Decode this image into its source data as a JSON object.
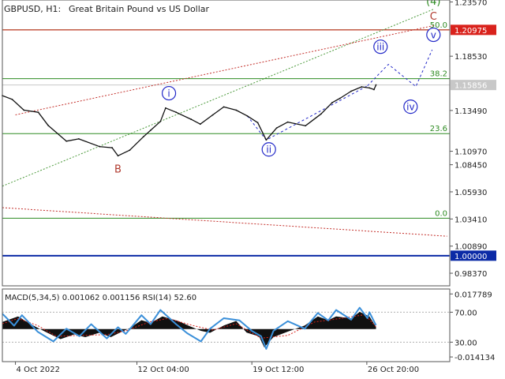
{
  "chart_data": {
    "type": "line",
    "symbol": "GBPUSD, H1:",
    "instrument": "Great Britain Pound vs US Dollar",
    "price_axis": {
      "ticks": [
        1.2357,
        1.1853,
        1.1349,
        1.097,
        1.0845,
        1.0593,
        1.0341,
        1.0089,
        0.9837
      ],
      "tick_labels": [
        "1.23570",
        "1.18530",
        "1.13490",
        "1.10970",
        "1.08450",
        "1.05930",
        "1.03410",
        "1.00890",
        "0.98370"
      ],
      "range": [
        0.972,
        1.2375
      ]
    },
    "price_tags": [
      {
        "value": 1.20975,
        "label": "1.20975",
        "color": "#d9221c",
        "text_color": "#ffffff"
      },
      {
        "value": 1.15856,
        "label": "1.15856",
        "color": "#c8c8c8",
        "text_color": "#ffffff"
      },
      {
        "value": 1.0,
        "label": "1.00000",
        "color": "#0b2aa6",
        "text_color": "#ffffff"
      }
    ],
    "fib_levels": [
      {
        "label": "50.0",
        "value": 1.2098
      },
      {
        "label": "38.2",
        "value": 1.1644
      },
      {
        "label": "23.6",
        "value": 1.1134
      },
      {
        "label": "0.0",
        "value": 1.0348
      }
    ],
    "wave_labels": [
      {
        "text": "(4)",
        "date": "2022-10-31 02:00",
        "price": 1.2365,
        "color": "#2e8b22",
        "circled": false
      },
      {
        "text": "C",
        "date": "2022-10-31 02:00",
        "price": 1.2225,
        "color": "#b03a2e",
        "circled": false
      },
      {
        "text": "v",
        "date": "2022-10-31 02:00",
        "price": 1.2052,
        "color": "#2228c8",
        "circled": true
      },
      {
        "text": "iii",
        "date": "2022-10-27 17:00",
        "price": 1.1941,
        "color": "#2228c8",
        "circled": true
      },
      {
        "text": "iv",
        "date": "2022-10-29 15:00",
        "price": 1.1384,
        "color": "#2228c8",
        "circled": true
      },
      {
        "text": "i",
        "date": "2022-10-14 05:00",
        "price": 1.1509,
        "color": "#2228c8",
        "circled": true
      },
      {
        "text": "ii",
        "date": "2022-10-20 14:00",
        "price": 1.0987,
        "color": "#2228c8",
        "circled": true
      },
      {
        "text": "B",
        "date": "2022-10-10 23:00",
        "price": 1.0805,
        "color": "#b03a2e",
        "circled": false
      }
    ],
    "forecast_path": [
      {
        "date": "2022-10-26 21:00",
        "price": 1.1578
      },
      {
        "date": "2022-10-28 05:00",
        "price": 1.1777
      },
      {
        "date": "2022-10-29 23:00",
        "price": 1.1571
      },
      {
        "date": "2022-10-31 00:00",
        "price": 1.1913
      }
    ],
    "wave_ii_path": [
      {
        "date": "2022-10-19 05:00",
        "price": 1.1298
      },
      {
        "date": "2022-10-20 10:00",
        "price": 1.1075
      },
      {
        "date": "2022-10-26 21:00",
        "price": 1.1578
      }
    ],
    "trend_lines": [
      {
        "color": "#4c9a3c",
        "from": {
          "date": "2022-10-03 14:00",
          "price": 1.0646
        },
        "to": {
          "date": "2022-10-31 02:00",
          "price": 1.2289
        }
      },
      {
        "color": "#c4302b",
        "from": {
          "date": "2022-10-04 10:00",
          "price": 1.1308
        },
        "to": {
          "date": "2022-10-31 02:00",
          "price": 1.2137
        }
      },
      {
        "color": "#c4302b",
        "from": {
          "date": "2022-10-03 14:00",
          "price": 1.0446
        },
        "to": {
          "date": "2022-10-31 23:00",
          "price": 1.0181
        }
      }
    ],
    "price_series": [
      {
        "date": "2022-10-03 14:00",
        "price": 1.1487
      },
      {
        "date": "2022-10-04 05:00",
        "price": 1.1452
      },
      {
        "date": "2022-10-04 23:00",
        "price": 1.1352
      },
      {
        "date": "2022-10-05 21:00",
        "price": 1.1332
      },
      {
        "date": "2022-10-06 12:00",
        "price": 1.1211
      },
      {
        "date": "2022-10-07 16:00",
        "price": 1.1064
      },
      {
        "date": "2022-10-08 11:00",
        "price": 1.1085
      },
      {
        "date": "2022-10-09 19:00",
        "price": 1.1013
      },
      {
        "date": "2022-10-10 14:00",
        "price": 1.1003
      },
      {
        "date": "2022-10-10 23:00",
        "price": 1.0928
      },
      {
        "date": "2022-10-11 17:00",
        "price": 1.098
      },
      {
        "date": "2022-10-12 14:00",
        "price": 1.1105
      },
      {
        "date": "2022-10-13 01:00",
        "price": 1.1165
      },
      {
        "date": "2022-10-13 16:00",
        "price": 1.1247
      },
      {
        "date": "2022-10-14 00:00",
        "price": 1.1372
      },
      {
        "date": "2022-10-14 16:00",
        "price": 1.1332
      },
      {
        "date": "2022-10-15 15:00",
        "price": 1.1267
      },
      {
        "date": "2022-10-16 05:00",
        "price": 1.1222
      },
      {
        "date": "2022-10-17 00:00",
        "price": 1.1307
      },
      {
        "date": "2022-10-17 17:00",
        "price": 1.1382
      },
      {
        "date": "2022-10-18 12:00",
        "price": 1.1352
      },
      {
        "date": "2022-10-19 05:00",
        "price": 1.1298
      },
      {
        "date": "2022-10-19 21:00",
        "price": 1.1236
      },
      {
        "date": "2022-10-20 10:00",
        "price": 1.1075
      },
      {
        "date": "2022-10-21 02:00",
        "price": 1.1186
      },
      {
        "date": "2022-10-21 19:00",
        "price": 1.1241
      },
      {
        "date": "2022-10-22 22:00",
        "price": 1.1207
      },
      {
        "date": "2022-10-23 22:00",
        "price": 1.1317
      },
      {
        "date": "2022-10-24 15:00",
        "price": 1.1422
      },
      {
        "date": "2022-10-25 03:00",
        "price": 1.1462
      },
      {
        "date": "2022-10-25 20:00",
        "price": 1.1528
      },
      {
        "date": "2022-10-26 12:00",
        "price": 1.1568
      },
      {
        "date": "2022-10-27 00:00",
        "price": 1.1558
      },
      {
        "date": "2022-10-27 07:00",
        "price": 1.1543
      },
      {
        "date": "2022-10-27 10:00",
        "price": 1.1586
      }
    ],
    "x_axis": {
      "ticks": [
        "2022-10-04 10:00",
        "2022-10-12 04:00",
        "2022-10-19 12:00",
        "2022-10-26 20:00"
      ],
      "tick_labels": [
        "4 Oct 2022",
        "12 Oct 04:00",
        "19 Oct 12:00",
        "26 Oct 20:00"
      ],
      "range": [
        "2022-10-03 14:00",
        "2022-11-01 03:00"
      ]
    },
    "indicator": {
      "title": "MACD(5,34,5) 0.001062 0.001156 RSI(14) 52.60",
      "macd_axis": {
        "ticks": [
          0.017789,
          -0.014134
        ],
        "tick_labels": [
          "0.017789",
          "-0.014134"
        ],
        "range": [
          -0.0165,
          0.0203
        ]
      },
      "rsi_axis": {
        "ticks": [
          70,
          30
        ],
        "tick_labels": [
          "70.00",
          "30.00"
        ],
        "range": [
          4,
          101
        ]
      },
      "macd": [
        {
          "date": "2022-10-03 14:00",
          "value": 0.0036
        },
        {
          "date": "2022-10-04 14:00",
          "value": 0.0064
        },
        {
          "date": "2022-10-05 08:00",
          "value": 0.0027
        },
        {
          "date": "2022-10-06 08:00",
          "value": -0.0014
        },
        {
          "date": "2022-10-07 07:00",
          "value": -0.0051
        },
        {
          "date": "2022-10-08 04:00",
          "value": -0.0027
        },
        {
          "date": "2022-10-08 21:00",
          "value": -0.0041
        },
        {
          "date": "2022-10-09 18:00",
          "value": -0.0019
        },
        {
          "date": "2022-10-10 12:00",
          "value": -0.0041
        },
        {
          "date": "2022-10-10 23:00",
          "value": -0.0023
        },
        {
          "date": "2022-10-11 17:00",
          "value": 0.0005
        },
        {
          "date": "2022-10-12 11:00",
          "value": 0.0045
        },
        {
          "date": "2022-10-13 01:00",
          "value": 0.0031
        },
        {
          "date": "2022-10-13 19:00",
          "value": 0.0064
        },
        {
          "date": "2022-10-14 19:00",
          "value": 0.0041
        },
        {
          "date": "2022-10-15 14:00",
          "value": 0.0013
        },
        {
          "date": "2022-10-16 06:00",
          "value": -0.0009
        },
        {
          "date": "2022-10-16 20:00",
          "value": -0.0019
        },
        {
          "date": "2022-10-17 17:00",
          "value": 0.0018
        },
        {
          "date": "2022-10-18 12:00",
          "value": 0.0041
        },
        {
          "date": "2022-10-19 04:00",
          "value": -0.0018
        },
        {
          "date": "2022-10-19 23:00",
          "value": -0.0037
        },
        {
          "date": "2022-10-20 07:00",
          "value": -0.0093
        },
        {
          "date": "2022-10-20 21:00",
          "value": -0.0041
        },
        {
          "date": "2022-10-21 19:00",
          "value": -0.0013
        },
        {
          "date": "2022-10-22 21:00",
          "value": 0.0018
        },
        {
          "date": "2022-10-23 17:00",
          "value": 0.0064
        },
        {
          "date": "2022-10-24 09:00",
          "value": 0.0045
        },
        {
          "date": "2022-10-24 21:00",
          "value": 0.0064
        },
        {
          "date": "2022-10-25 20:00",
          "value": 0.0054
        },
        {
          "date": "2022-10-26 09:00",
          "value": 0.0087
        },
        {
          "date": "2022-10-27 00:00",
          "value": 0.0064
        },
        {
          "date": "2022-10-27 10:00",
          "value": 0.0011
        }
      ],
      "signal": [
        {
          "date": "2022-10-03 14:00",
          "value": 0.0027
        },
        {
          "date": "2022-10-04 14:00",
          "value": 0.0054
        },
        {
          "date": "2022-10-05 20:00",
          "value": 0.0018
        },
        {
          "date": "2022-10-07 01:00",
          "value": -0.0037
        },
        {
          "date": "2022-10-08 12:00",
          "value": -0.0032
        },
        {
          "date": "2022-10-10 06:00",
          "value": -0.0028
        },
        {
          "date": "2022-10-11 11:00",
          "value": -0.0009
        },
        {
          "date": "2022-10-12 23:00",
          "value": 0.0036
        },
        {
          "date": "2022-10-14 03:00",
          "value": 0.0054
        },
        {
          "date": "2022-10-15 18:00",
          "value": 0.0018
        },
        {
          "date": "2022-10-17 00:00",
          "value": -0.0005
        },
        {
          "date": "2022-10-18 12:00",
          "value": 0.0027
        },
        {
          "date": "2022-10-20 02:00",
          "value": -0.0046
        },
        {
          "date": "2022-10-21 19:00",
          "value": -0.0032
        },
        {
          "date": "2022-10-23 12:00",
          "value": 0.0036
        },
        {
          "date": "2022-10-25 04:00",
          "value": 0.0054
        },
        {
          "date": "2022-10-26 17:00",
          "value": 0.0073
        },
        {
          "date": "2022-10-27 10:00",
          "value": 0.0012
        }
      ],
      "rsi": [
        {
          "date": "2022-10-03 14:00",
          "value": 68
        },
        {
          "date": "2022-10-04 08:00",
          "value": 52
        },
        {
          "date": "2022-10-04 20:00",
          "value": 66
        },
        {
          "date": "2022-10-05 20:00",
          "value": 44
        },
        {
          "date": "2022-10-06 20:00",
          "value": 31
        },
        {
          "date": "2022-10-07 16:00",
          "value": 48
        },
        {
          "date": "2022-10-08 12:00",
          "value": 38
        },
        {
          "date": "2022-10-09 06:00",
          "value": 54
        },
        {
          "date": "2022-10-10 06:00",
          "value": 35
        },
        {
          "date": "2022-10-10 23:00",
          "value": 50
        },
        {
          "date": "2022-10-11 11:00",
          "value": 41
        },
        {
          "date": "2022-10-12 11:00",
          "value": 66
        },
        {
          "date": "2022-10-13 01:00",
          "value": 54
        },
        {
          "date": "2022-10-13 16:00",
          "value": 73
        },
        {
          "date": "2022-10-14 16:00",
          "value": 54
        },
        {
          "date": "2022-10-15 09:00",
          "value": 42
        },
        {
          "date": "2022-10-16 06:00",
          "value": 31
        },
        {
          "date": "2022-10-16 20:00",
          "value": 48
        },
        {
          "date": "2022-10-17 17:00",
          "value": 62
        },
        {
          "date": "2022-10-18 17:00",
          "value": 59
        },
        {
          "date": "2022-10-19 12:00",
          "value": 45
        },
        {
          "date": "2022-10-20 02:00",
          "value": 38
        },
        {
          "date": "2022-10-20 10:00",
          "value": 21
        },
        {
          "date": "2022-10-20 21:00",
          "value": 45
        },
        {
          "date": "2022-10-21 19:00",
          "value": 58
        },
        {
          "date": "2022-10-22 21:00",
          "value": 48
        },
        {
          "date": "2022-10-23 17:00",
          "value": 69
        },
        {
          "date": "2022-10-24 09:00",
          "value": 59
        },
        {
          "date": "2022-10-24 21:00",
          "value": 73
        },
        {
          "date": "2022-10-25 20:00",
          "value": 60
        },
        {
          "date": "2022-10-26 09:00",
          "value": 76
        },
        {
          "date": "2022-10-26 21:00",
          "value": 62
        },
        {
          "date": "2022-10-27 00:00",
          "value": 70
        },
        {
          "date": "2022-10-27 10:00",
          "value": 52.6
        }
      ]
    }
  }
}
